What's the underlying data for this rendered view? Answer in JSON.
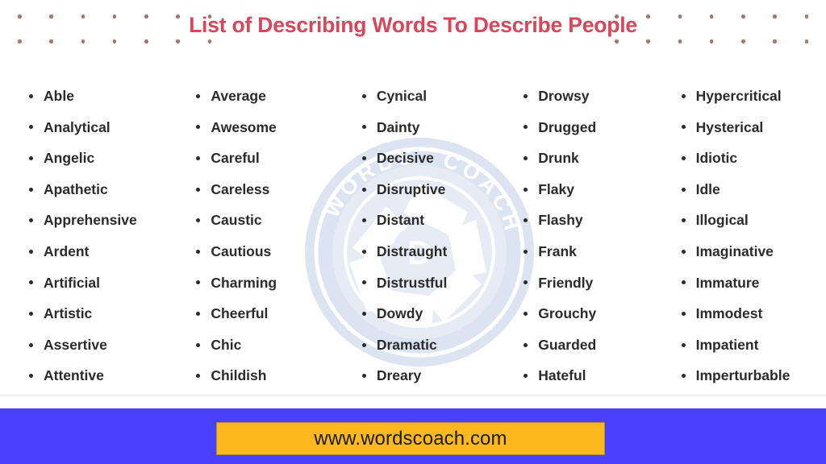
{
  "page": {
    "title": "List of Describing Words To Describe People",
    "background_color": "#ffffff",
    "title_color": "#d9455a",
    "text_color": "#2b2b2b",
    "dot_color": "#a8756e"
  },
  "decor": {
    "dots_per_row": 7,
    "rows": 2
  },
  "watermark": {
    "brand_top": "WORDS",
    "brand_bottom": "COACH",
    "center_letter": "D",
    "color": "#dce3f0"
  },
  "columns": [
    {
      "id": "column-1",
      "words": [
        "Able",
        "Analytical",
        "Angelic",
        "Apathetic",
        "Apprehensive",
        "Ardent",
        "Artificial",
        "Artistic",
        "Assertive",
        "Attentive"
      ]
    },
    {
      "id": "column-2",
      "words": [
        "Average",
        "Awesome",
        "Careful",
        "Careless",
        "Caustic",
        "Cautious",
        "Charming",
        "Cheerful",
        "Chic",
        "Childish"
      ]
    },
    {
      "id": "column-3",
      "words": [
        "Cynical",
        "Dainty",
        "Decisive",
        "Disruptive",
        "Distant",
        "Distraught",
        "Distrustful",
        "Dowdy",
        "Dramatic",
        "Dreary"
      ]
    },
    {
      "id": "column-4",
      "words": [
        "Drowsy",
        "Drugged",
        "Drunk",
        "Flaky",
        "Flashy",
        "Frank",
        "Friendly",
        "Grouchy",
        "Guarded",
        "Hateful"
      ]
    },
    {
      "id": "column-5",
      "words": [
        "Hypercritical",
        "Hysterical",
        "Idiotic",
        "Idle",
        "Illogical",
        "Imaginative",
        "Immature",
        "Immodest",
        "Impatient",
        "Imperturbable"
      ]
    }
  ],
  "footer": {
    "url": "www.wordscoach.com",
    "bar_color": "#4a41fc",
    "button_color": "#fcb81c",
    "url_color": "#1a1a1a"
  }
}
